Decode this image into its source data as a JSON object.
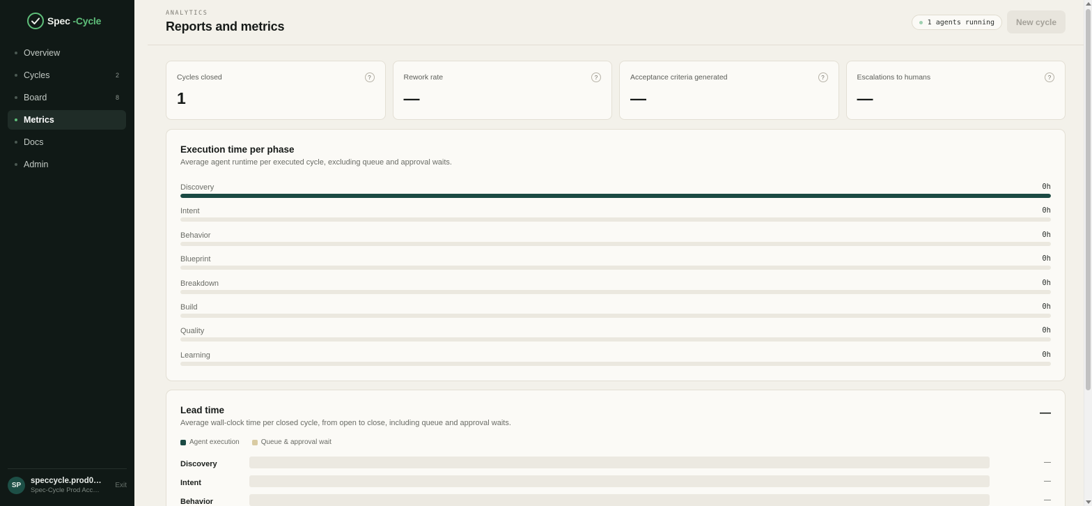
{
  "app": {
    "brand_left": "Spec",
    "brand_right": "-Cycle"
  },
  "colors": {
    "sidebar_bg": "#101916",
    "accent_green": "#5fbf7a",
    "bar_fill": "#1b4a43",
    "queue_color": "#d9cba2",
    "page_bg": "#f3f1ea"
  },
  "sidebar": {
    "items": [
      {
        "label": "Overview",
        "count": ""
      },
      {
        "label": "Cycles",
        "count": "2"
      },
      {
        "label": "Board",
        "count": "8"
      },
      {
        "label": "Metrics",
        "count": "",
        "active": true
      },
      {
        "label": "Docs",
        "count": ""
      },
      {
        "label": "Admin",
        "count": ""
      }
    ],
    "user": {
      "initials": "SP",
      "name": "speccycle.prod01…",
      "account": "Spec-Cycle Prod Accou…",
      "exit_label": "Exit"
    }
  },
  "header": {
    "eyebrow": "ANALYTICS",
    "title": "Reports and metrics",
    "agents_status": "1 agents running",
    "new_cycle_label": "New cycle"
  },
  "kpis": [
    {
      "label": "Cycles closed",
      "value": "1",
      "help": "?"
    },
    {
      "label": "Rework rate",
      "value": "—",
      "help": "?"
    },
    {
      "label": "Acceptance criteria generated",
      "value": "—",
      "help": "?"
    },
    {
      "label": "Escalations to humans",
      "value": "—",
      "help": "?"
    }
  ],
  "execution": {
    "title": "Execution time per phase",
    "subtitle": "Average agent runtime per executed cycle, excluding queue and approval waits.",
    "phases": [
      {
        "name": "Discovery",
        "value": "0h",
        "fill": 1.0
      },
      {
        "name": "Intent",
        "value": "0h",
        "fill": 0
      },
      {
        "name": "Behavior",
        "value": "0h",
        "fill": 0
      },
      {
        "name": "Blueprint",
        "value": "0h",
        "fill": 0
      },
      {
        "name": "Breakdown",
        "value": "0h",
        "fill": 0
      },
      {
        "name": "Build",
        "value": "0h",
        "fill": 0
      },
      {
        "name": "Quality",
        "value": "0h",
        "fill": 0
      },
      {
        "name": "Learning",
        "value": "0h",
        "fill": 0
      }
    ]
  },
  "lead_time": {
    "title": "Lead time",
    "subtitle": "Average wall-clock time per closed cycle, from open to close, including queue and approval waits.",
    "total": "—",
    "legend": {
      "agent": "Agent execution",
      "queue": "Queue & approval wait"
    },
    "rows": [
      {
        "name": "Discovery",
        "value": "—"
      },
      {
        "name": "Intent",
        "value": "—"
      },
      {
        "name": "Behavior",
        "value": "—"
      }
    ]
  }
}
